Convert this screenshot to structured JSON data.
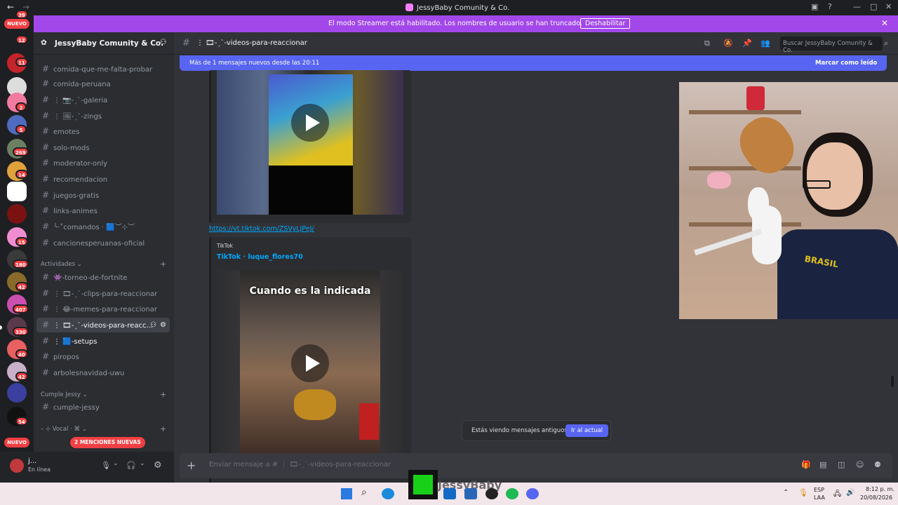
{
  "titlebar": {
    "title": "JessyBaby Comunity & Co."
  },
  "banner": {
    "message": "El modo Streamer está habilitado. Los nombres de usuario se han truncado.",
    "button": "Deshabilitar"
  },
  "guilds": {
    "new_top": "NUEVO",
    "new_bottom": "NUEVO",
    "badges": [
      "39",
      "12",
      "11",
      "2",
      "5",
      "269",
      "14",
      "15",
      "180",
      "42",
      "407",
      "330",
      "40",
      "42",
      "54"
    ]
  },
  "server": {
    "name": "JessyBaby Comunity & Co."
  },
  "channels": [
    {
      "name": "comida-que-me-falta-probar"
    },
    {
      "name": "comida-peruana"
    },
    {
      "name": "⋮ 📷-ˏˋ-galeria"
    },
    {
      "name": "⋮ 🖼-ˏˋ-zings"
    },
    {
      "name": "emotes"
    },
    {
      "name": "solo-mods"
    },
    {
      "name": "moderator-only"
    },
    {
      "name": "recomendacion"
    },
    {
      "name": "juegos-gratis"
    },
    {
      "name": "links-animes"
    },
    {
      "name": "╰‧˚comandos ‧ 🟦︶⊹︶"
    },
    {
      "name": "cancionesperuanas-oficial"
    }
  ],
  "cat_actividades": "Actividades",
  "actividades": [
    {
      "name": "👾-torneo-de-fortnite"
    },
    {
      "name": "⋮ 🎞-ˏˋ-clips-para-reaccionar"
    },
    {
      "name": "⋮ 😂-memes-para-reaccionar"
    },
    {
      "name": "⋮ 🎞-ˏˋ-videos-para-reacc..."
    },
    {
      "name": "⋮ 🟦-setups"
    },
    {
      "name": "piropos"
    },
    {
      "name": "arbolesnavidad-uwu"
    }
  ],
  "cat_cumple": "Cumple Jessy",
  "cumple": [
    {
      "name": "cumple-jessy"
    }
  ],
  "cat_vocal": "⊹ Vocal · ⌘",
  "mentions": "2 MENCIONES NUEVAS",
  "user": {
    "name": "j...",
    "status": "En línea"
  },
  "channel_header": {
    "name": "⋮ 🎞-ˏˋ-videos-para-reaccionar",
    "search": "Buscar JessyBaby Comunity & Co."
  },
  "new_messages": {
    "text": "Más de 1 mensajes nuevos desde las 20:11",
    "action": "Marcar como leído"
  },
  "message": {
    "link": "https://vt.tiktok.com/ZSVyLJPeJ/",
    "provider": "TikTok",
    "author": "TikTok · luque_flores70",
    "video_caption": "Cuando es la indicada"
  },
  "old_messages": {
    "text": "Estás viendo mensajes antiguos",
    "button": "Ir al actual"
  },
  "composer": {
    "placeholder": "Enviar mensaje a # ⋮ 🎞-ˏˋ-videos-para-reaccionar"
  },
  "watermark": "JessyBaby",
  "tray": {
    "lang1": "ESP",
    "lang2": "LAA",
    "time": "8:12 p. m.",
    "date": "20/08/2026"
  },
  "colors": {
    "blurple": "#5865f2",
    "streamer": "#a248eb",
    "mention": "#f23f43"
  }
}
